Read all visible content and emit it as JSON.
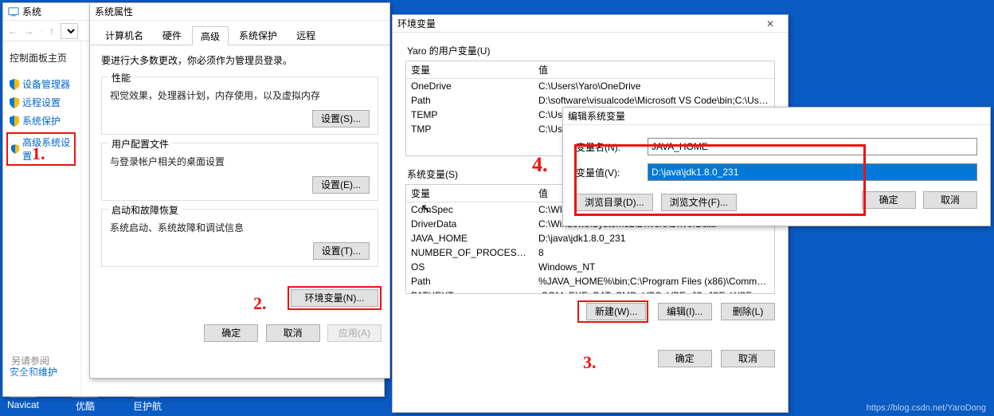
{
  "system_window": {
    "title": "系统",
    "sidebar_heading": "控制面板主页",
    "items": [
      "设备管理器",
      "远程设置",
      "系统保护",
      "高级系统设置"
    ],
    "see_also": "另请参阅",
    "security": "安全和维护"
  },
  "properties_window": {
    "title": "系统属性",
    "tabs": [
      "计算机名",
      "硬件",
      "高级",
      "系统保护",
      "远程"
    ],
    "active_tab": 2,
    "note": "要进行大多数更改，你必须作为管理员登录。",
    "group_perf": {
      "title": "性能",
      "desc": "视觉效果，处理器计划，内存使用，以及虚拟内存",
      "btn": "设置(S)..."
    },
    "group_profile": {
      "title": "用户配置文件",
      "desc": "与登录帐户相关的桌面设置",
      "btn": "设置(E)..."
    },
    "group_startup": {
      "title": "启动和故障恢复",
      "desc": "系统启动、系统故障和调试信息",
      "btn": "设置(T)..."
    },
    "env_btn": "环境变量(N)...",
    "ok": "确定",
    "cancel": "取消",
    "apply": "应用(A)"
  },
  "env_window": {
    "title": "环境变量",
    "user_label": "Yaro 的用户变量(U)",
    "sys_label": "系统变量(S)",
    "col_var": "变量",
    "col_val": "值",
    "user_vars": [
      {
        "k": "OneDrive",
        "v": "C:\\Users\\Yaro\\OneDrive"
      },
      {
        "k": "Path",
        "v": "D:\\software\\visualcode\\Microsoft VS Code\\bin;C:\\Users\\Yaro\\A..."
      },
      {
        "k": "TEMP",
        "v": "C:\\Users\\Yaro\\..."
      },
      {
        "k": "TMP",
        "v": "C:\\Users\\Yaro\\..."
      }
    ],
    "sys_vars": [
      {
        "k": "ComSpec",
        "v": "C:\\WINDOWS\\system32\\cmd.exe"
      },
      {
        "k": "DriverData",
        "v": "C:\\Windows\\System32\\Drivers\\DriverData"
      },
      {
        "k": "JAVA_HOME",
        "v": "D:\\java\\jdk1.8.0_231"
      },
      {
        "k": "NUMBER_OF_PROCESSORS",
        "v": "8"
      },
      {
        "k": "OS",
        "v": "Windows_NT"
      },
      {
        "k": "Path",
        "v": "%JAVA_HOME%\\bin;C:\\Program Files (x86)\\Common Files\\Oracl..."
      },
      {
        "k": "PATHEXT",
        "v": ".COM;.EXE;.BAT;.CMD;.VBS;.VBE;.JS;.JSE;.WSF;.WSH;.MSC"
      }
    ],
    "new_btn": "新建(W)...",
    "edit_btn": "编辑(I)...",
    "del_btn": "删除(L)",
    "ok": "确定",
    "cancel": "取消"
  },
  "edit_dialog": {
    "title": "编辑系统变量",
    "name_label": "变量名(N):",
    "value_label": "变量值(V):",
    "name_value": "JAVA_HOME",
    "value_value": "D:\\java\\jdk1.8.0_231",
    "browse_dir": "浏览目录(D)...",
    "browse_file": "浏览文件(F)...",
    "ok": "确定",
    "cancel": "取消"
  },
  "annotations": {
    "n1": "1.",
    "n2": "2.",
    "n3": "3.",
    "n4": "4."
  },
  "desktop": {
    "icons": [
      "Navicat",
      "优酷",
      "巨护航"
    ]
  },
  "watermark": "https://blog.csdn.net/YaroDong"
}
